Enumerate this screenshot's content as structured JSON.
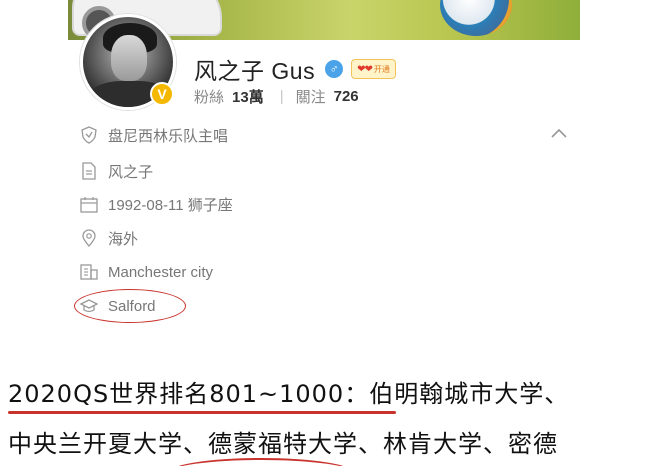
{
  "profile": {
    "username": "风之子 Gus",
    "gender_icon": "male-icon",
    "vip_badge_text": "开通",
    "stats": {
      "fans_label": "粉絲",
      "fans_value": "13萬",
      "following_label": "關注",
      "following_value": "726"
    }
  },
  "info": [
    {
      "icon": "verified-shield-icon",
      "text": "盘尼西林乐队主唱"
    },
    {
      "icon": "document-icon",
      "text": "风之子"
    },
    {
      "icon": "calendar-icon",
      "text": "1992-08-11 狮子座"
    },
    {
      "icon": "location-pin-icon",
      "text": "海外"
    },
    {
      "icon": "company-icon",
      "text": "Manchester city"
    },
    {
      "icon": "graduation-cap-icon",
      "text": "Salford"
    }
  ],
  "caption": {
    "line1": "2020QS世界排名801~1000：伯明翰城市大学、",
    "line2": "中央兰开夏大学、德蒙福特大学、林肯大学、密德"
  },
  "colors": {
    "annotation_red": "#c9332d",
    "verified_gold": "#f5b800",
    "gender_blue": "#4aa3e8"
  }
}
